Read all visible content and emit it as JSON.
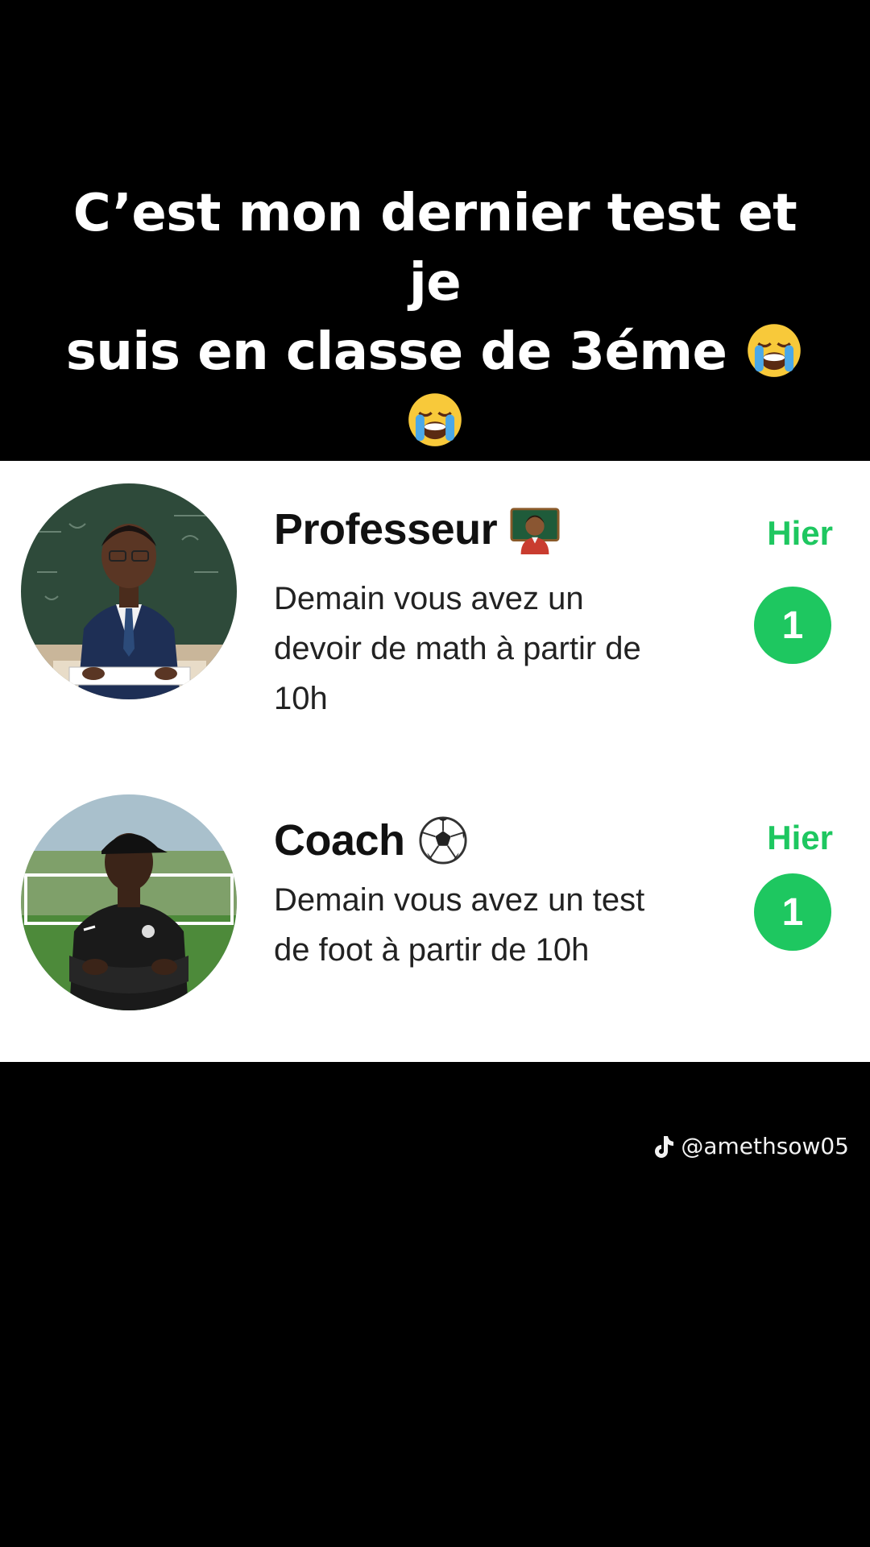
{
  "caption": {
    "line1": "C’est mon dernier test et je",
    "line2": "suis en classe de 3éme",
    "emoji_icon": "loudly-crying-face-icon",
    "emoji_count_line2": 2,
    "emoji_count_line3": 2
  },
  "chats": [
    {
      "name": "Professeur",
      "name_icon": "teacher-icon",
      "message": "Demain vous avez un devoir de math à partir de 10h",
      "time": "Hier",
      "unread": "1",
      "avatar_icon": "teacher-avatar-icon"
    },
    {
      "name": "Coach",
      "name_icon": "soccer-ball-icon",
      "message": "Demain vous avez un test de foot à partir de 10h",
      "time": "Hier",
      "unread": "1",
      "avatar_icon": "coach-avatar-icon"
    }
  ],
  "watermark": {
    "handle": "@amethsow05",
    "icon": "tiktok-icon"
  },
  "colors": {
    "accent": "#1ec760",
    "background": "#000000",
    "card": "#ffffff"
  }
}
